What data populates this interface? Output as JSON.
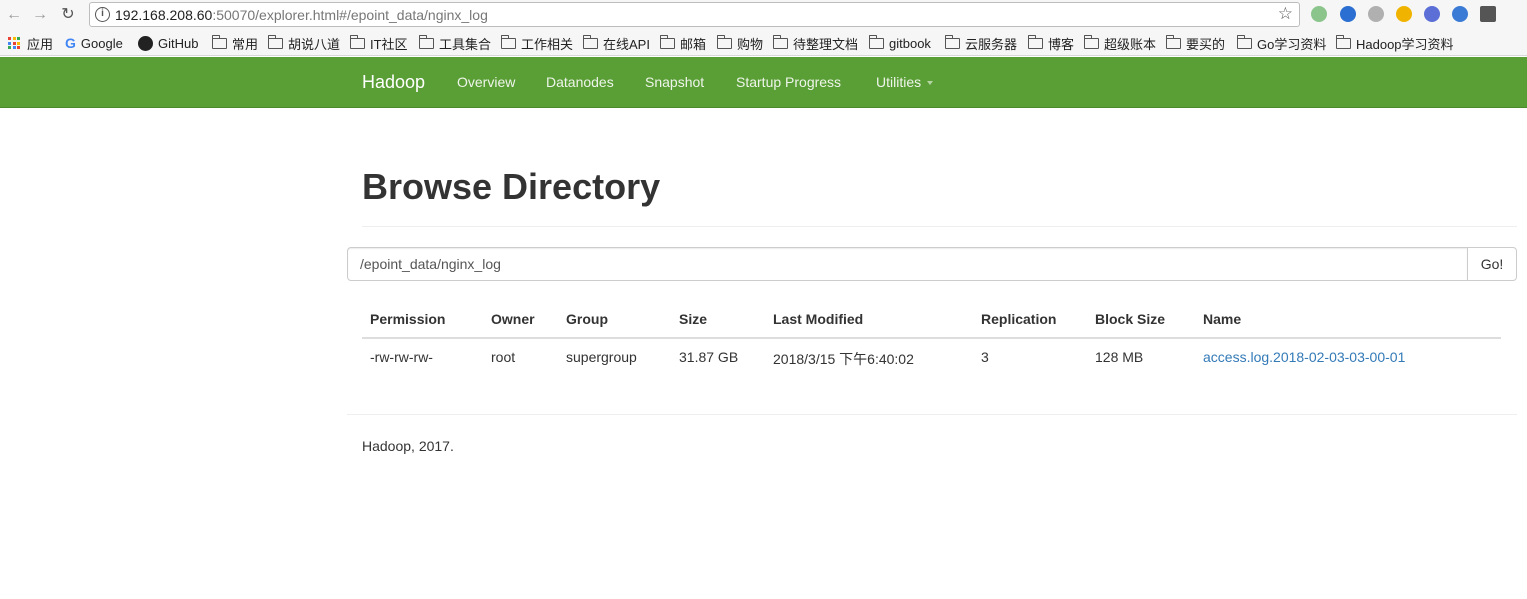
{
  "browser": {
    "url_host": "192.168.208.60",
    "url_rest": ":50070/explorer.html#/epoint_data/nginx_log",
    "extensions": [
      {
        "name": "circle-extension-icon",
        "color": "#8bc58b"
      },
      {
        "name": "v-extension-icon",
        "color": "#2a6fd1"
      },
      {
        "name": "tree-extension-icon",
        "color": "#b0b0b0"
      },
      {
        "name": "check-extension-icon",
        "color": "#f0b400"
      },
      {
        "name": "ws-extension-icon",
        "color": "#5b6fd6"
      },
      {
        "name": "globe-extension-icon",
        "color": "#3b7bd5"
      },
      {
        "name": "01-extension-icon",
        "color": "#555555"
      }
    ]
  },
  "bookmarks": [
    {
      "label": "应用",
      "icon": "apps-grid-icon"
    },
    {
      "label": "Google",
      "icon": "google-icon"
    },
    {
      "label": "GitHub",
      "icon": "github-icon"
    },
    {
      "label": "常用",
      "icon": "folder-icon"
    },
    {
      "label": "胡说八道",
      "icon": "folder-icon"
    },
    {
      "label": "IT社区",
      "icon": "folder-icon"
    },
    {
      "label": "工具集合",
      "icon": "folder-icon"
    },
    {
      "label": "工作相关",
      "icon": "folder-icon"
    },
    {
      "label": "在线API",
      "icon": "folder-icon"
    },
    {
      "label": "邮箱",
      "icon": "folder-icon"
    },
    {
      "label": "购物",
      "icon": "folder-icon"
    },
    {
      "label": "待整理文档",
      "icon": "folder-icon"
    },
    {
      "label": "gitbook",
      "icon": "folder-icon"
    },
    {
      "label": "云服务器",
      "icon": "folder-icon"
    },
    {
      "label": "博客",
      "icon": "folder-icon"
    },
    {
      "label": "超级账本",
      "icon": "folder-icon"
    },
    {
      "label": "要买的",
      "icon": "folder-icon"
    },
    {
      "label": "Go学习资料",
      "icon": "folder-icon"
    },
    {
      "label": "Hadoop学习资料",
      "icon": "folder-icon"
    }
  ],
  "navbar": {
    "brand": "Hadoop",
    "links": [
      "Overview",
      "Datanodes",
      "Snapshot",
      "Startup Progress",
      "Utilities"
    ],
    "color": "#5a9e36"
  },
  "page": {
    "title": "Browse Directory",
    "path_value": "/epoint_data/nginx_log",
    "go_label": "Go!"
  },
  "table": {
    "headers": [
      "Permission",
      "Owner",
      "Group",
      "Size",
      "Last Modified",
      "Replication",
      "Block Size",
      "Name"
    ],
    "rows": [
      [
        "-rw-rw-rw-",
        "root",
        "supergroup",
        "31.87 GB",
        "2018/3/15 下午6:40:02",
        "3",
        "128 MB",
        "access.log.2018-02-03-03-00-01"
      ]
    ]
  },
  "footer": {
    "text": "Hadoop, 2017."
  }
}
